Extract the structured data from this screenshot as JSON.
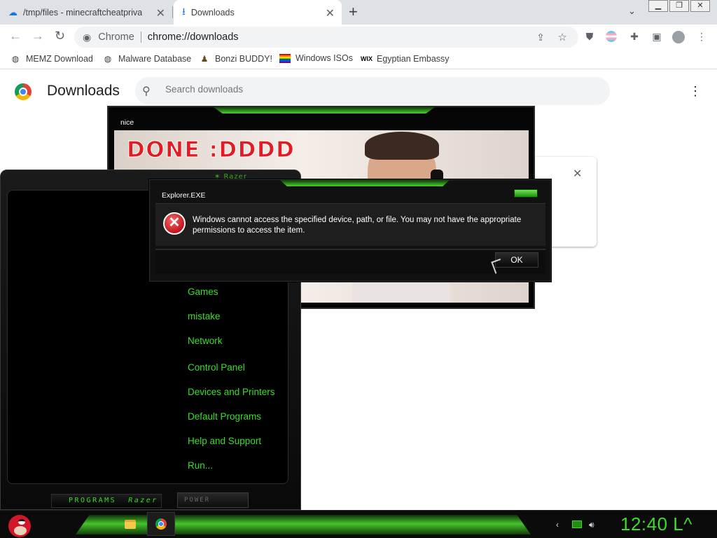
{
  "browser": {
    "tabs": [
      {
        "title": "/tmp/files - minecraftcheatprivat"
      },
      {
        "title": "Downloads"
      }
    ],
    "omnibox": {
      "site_chip": "Chrome",
      "url": "chrome://downloads"
    },
    "bookmarks": [
      {
        "label": "MEMZ Download"
      },
      {
        "label": "Malware Database"
      },
      {
        "label": "Bonzi BUDDY!"
      },
      {
        "label": "Windows ISOs"
      },
      {
        "label": "Egyptian Embassy"
      }
    ]
  },
  "downloads_page": {
    "title": "Downloads",
    "search_placeholder": "Search downloads"
  },
  "image_window": {
    "title": "nice",
    "meme_text": "DONE :DDDD"
  },
  "error_dialog": {
    "title": "Explorer.EXE",
    "message": "Windows cannot access the specified device, path, or file.  You may not have the appropriate permissions to access the item.",
    "ok_label": "OK"
  },
  "start_menu": {
    "items": [
      {
        "label": "Games"
      },
      {
        "label": "mistake"
      },
      {
        "label": "Network"
      },
      {
        "label": "Control Panel"
      },
      {
        "label": "Devices and Printers"
      },
      {
        "label": "Default Programs"
      },
      {
        "label": "Help and Support"
      },
      {
        "label": "Run..."
      }
    ],
    "programs_label": "PROGRAMS",
    "programs_brand": "Razer",
    "power_label": "POWER"
  },
  "taskbar": {
    "clock": "12:40 L^"
  },
  "colors": {
    "accent_green": "#3bdd2a",
    "error_red": "#c4141b",
    "chrome_grey": "#dee1e6"
  },
  "icons": [
    "cloud-icon",
    "download-icon",
    "close-icon",
    "plus-icon",
    "back-icon",
    "forward-icon",
    "reload-icon",
    "share-icon",
    "star-icon",
    "extension-icon",
    "profile-icon",
    "search-icon",
    "more-vert-icon",
    "error-icon",
    "folder-icon",
    "volume-icon"
  ]
}
